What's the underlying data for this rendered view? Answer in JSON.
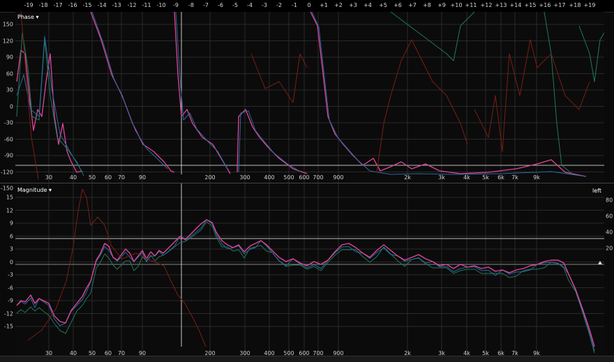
{
  "ruler_labels": [
    "-19",
    "-18",
    "-17",
    "-16",
    "-15",
    "-14",
    "-13",
    "-12",
    "-11",
    "-10",
    "-9",
    "-8",
    "-7",
    "-6",
    "-5",
    "-4",
    "-3",
    "-2",
    "-1",
    "0",
    "+1",
    "+2",
    "+3",
    "+4",
    "+5",
    "+6",
    "+7",
    "+8",
    "+9",
    "+10",
    "+11",
    "+12",
    "+13",
    "+14",
    "+15",
    "+16",
    "+17",
    "+18",
    "+19"
  ],
  "phase": {
    "title": "Phase",
    "dropdown_icon": "triangle-down-icon",
    "y_labels": [
      "150",
      "120",
      "90",
      "60",
      "30",
      "0",
      "-30",
      "-60",
      "-90",
      "-120",
      "-150"
    ],
    "x_labels": [
      "30",
      "40",
      "50",
      "60",
      "70",
      "90",
      "200",
      "300",
      "400",
      "500",
      "600",
      "700",
      "900",
      "2k",
      "3k",
      "4k",
      "5k",
      "6k",
      "7k",
      "9k"
    ]
  },
  "magnitude": {
    "title": "Magnitude",
    "dropdown_icon": "triangle-down-icon",
    "y_labels": [
      "15",
      "12",
      "9",
      "6",
      "3",
      "0",
      "-3",
      "-6",
      "-9",
      "-12",
      "-15"
    ],
    "right_labels": [
      "80",
      "60",
      "40",
      "20"
    ],
    "channel_label": "left",
    "x_labels": [
      "30",
      "40",
      "50",
      "60",
      "70",
      "90",
      "200",
      "300",
      "400",
      "500",
      "600",
      "700",
      "900",
      "2k",
      "3k",
      "4k",
      "5k",
      "6k",
      "7k",
      "9k"
    ]
  },
  "colors": {
    "pink": "#e0459a",
    "blue": "#2a6aa0",
    "green": "#1f7a58",
    "darkred": "#7a1e16",
    "grid": "#2a2a2a",
    "cursor": "#c8c8c8"
  }
}
